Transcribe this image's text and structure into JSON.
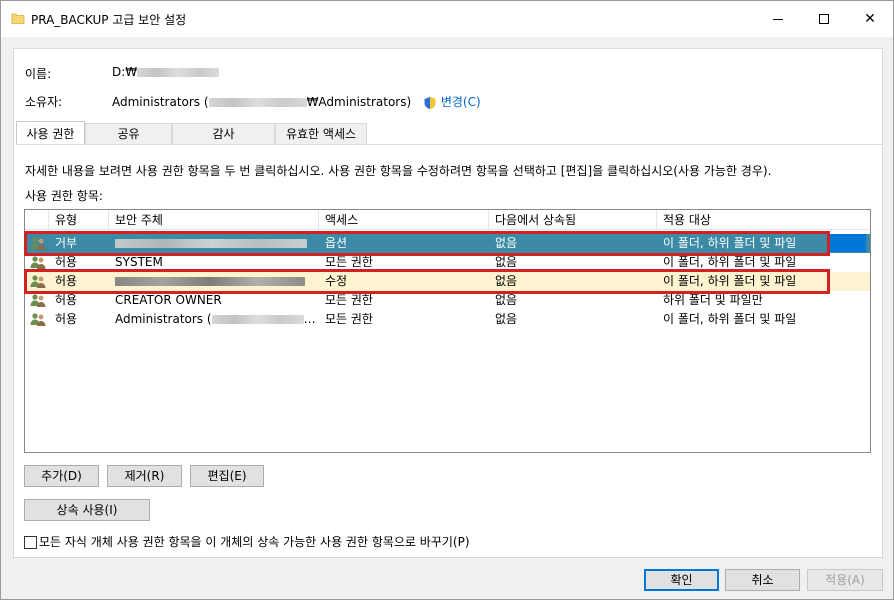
{
  "window": {
    "title": "PRA_BACKUP 고급 보안 설정",
    "close_glyph": "✕"
  },
  "info": {
    "name_label": "이름:",
    "name_value": "D:₩",
    "owner_label": "소유자:",
    "owner_value_prefix": "Administrators (",
    "owner_value_suffix": "₩Administrators)",
    "change_link": "변경(C)"
  },
  "tabs": [
    "사용 권한",
    "공유",
    "감사",
    "유효한 액세스"
  ],
  "description": "자세한 내용을 보려면 사용 권한 항목을 두 번 클릭하십시오. 사용 권한 항목을 수정하려면 항목을 선택하고 [편집]을 클릭하십시오(사용 가능한 경우).",
  "list_label": "사용 권한 항목:",
  "table": {
    "columns": [
      "유형",
      "보안 주체",
      "액세스",
      "다음에서 상속됨",
      "적용 대상"
    ],
    "rows": [
      {
        "type": "거부",
        "principal": "",
        "access": "옵션",
        "inherited": "없음",
        "applies": "이 폴더, 하위 폴더 및 파일"
      },
      {
        "type": "허용",
        "principal": "SYSTEM",
        "access": "모든 권한",
        "inherited": "없음",
        "applies": "이 폴더, 하위 폴더 및 파일"
      },
      {
        "type": "허용",
        "principal": "",
        "access": "수정",
        "inherited": "없음",
        "applies": "이 폴더, 하위 폴더 및 파일"
      },
      {
        "type": "허용",
        "principal": "CREATOR OWNER",
        "access": "모든 권한",
        "inherited": "없음",
        "applies": "하위 폴더 및 파일만"
      },
      {
        "type": "허용",
        "principal": "Administrators (",
        "access": "모든 권한",
        "inherited": "없음",
        "applies": "이 폴더, 하위 폴더 및 파일"
      }
    ]
  },
  "buttons": {
    "add": "추가(D)",
    "remove": "제거(R)",
    "edit": "편집(E)",
    "inherit": "상속 사용(I)",
    "ok": "확인",
    "cancel": "취소",
    "apply": "적용(A)"
  },
  "checkbox_label": "모든 자식 개체 사용 권한 항목을 이 개체의 상속 가능한 사용 권한 항목으로 바꾸기(P)",
  "colors": {
    "selected_row": "#3c8aa5",
    "highlight_row": "#fdf3d0",
    "annotation_red": "#d32020",
    "link": "#0066cc"
  }
}
